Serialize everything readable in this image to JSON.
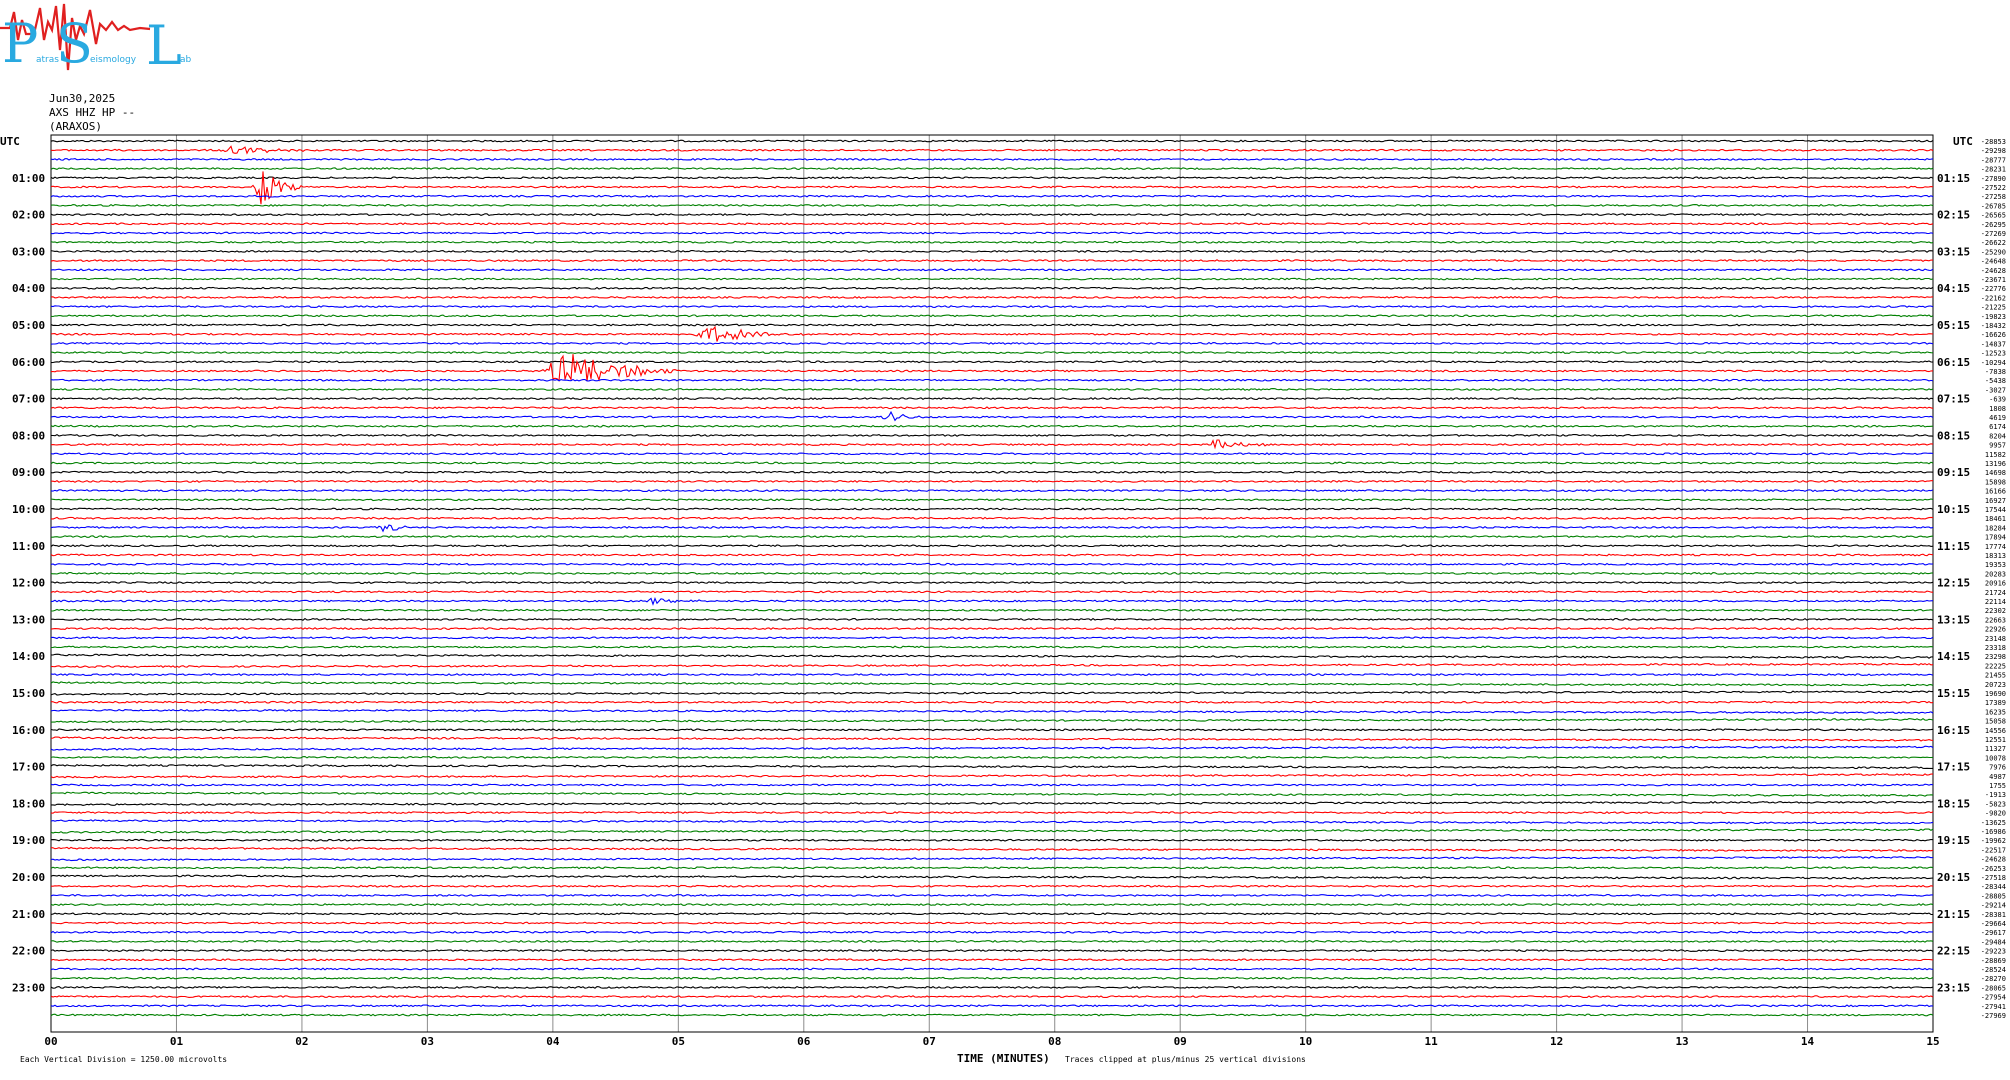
{
  "logo": {
    "letters": [
      "P",
      "S",
      "L"
    ],
    "small_text": [
      "atras",
      "eismology",
      "ab"
    ]
  },
  "header": {
    "date": "Jun30,2025",
    "channel": "AXS HHZ HP --",
    "station": "(ARAXOS)"
  },
  "colors": [
    "#000000",
    "#ff0000",
    "#0000ff",
    "#008000"
  ],
  "chart_data": {
    "type": "line",
    "subtype": "helicorder",
    "left_axis_label": "UTC",
    "right_axis_label": "UTC",
    "hour_labels_left": [
      "01:00",
      "02:00",
      "03:00",
      "04:00",
      "05:00",
      "06:00",
      "07:00",
      "08:00",
      "09:00",
      "10:00",
      "11:00",
      "12:00",
      "13:00",
      "14:00",
      "15:00",
      "16:00",
      "17:00",
      "18:00",
      "19:00",
      "20:00",
      "21:00",
      "22:00",
      "23:00"
    ],
    "hour_labels_right": [
      "01:15",
      "02:15",
      "03:15",
      "04:15",
      "05:15",
      "06:15",
      "07:15",
      "08:15",
      "09:15",
      "10:15",
      "11:15",
      "12:15",
      "13:15",
      "14:15",
      "15:15",
      "16:15",
      "17:15",
      "18:15",
      "19:15",
      "20:15",
      "21:15",
      "22:15",
      "23:15"
    ],
    "x_ticks": [
      "00",
      "01",
      "02",
      "03",
      "04",
      "05",
      "06",
      "07",
      "08",
      "09",
      "10",
      "11",
      "12",
      "13",
      "14",
      "15"
    ],
    "xlabel": "TIME (MINUTES)",
    "xlim": [
      0,
      15
    ],
    "offsets": [
      "-28853",
      "-29298",
      "-28777",
      "-28231",
      "-27890",
      "-27522",
      "-27258",
      "-26785",
      "-26565",
      "-26295",
      "-27269",
      "-26622",
      "-25290",
      "-24648",
      "-24628",
      "-23671",
      "-22776",
      "-22162",
      "-21225",
      "-19823",
      "-18432",
      "-16626",
      "-14837",
      "-12523",
      "-10294",
      "-7838",
      "-5438",
      "-3027",
      "-639",
      "1808",
      "4619",
      "6174",
      "8204",
      "9957",
      "11582",
      "13196",
      "14698",
      "15898",
      "16166",
      "16927",
      "17544",
      "18461",
      "18284",
      "17894",
      "17774",
      "18313",
      "19353",
      "20283",
      "20916",
      "21724",
      "22114",
      "22302",
      "22663",
      "22926",
      "23148",
      "23318",
      "23298",
      "22225",
      "21455",
      "20723",
      "19690",
      "17389",
      "16235",
      "15058",
      "14556",
      "12551",
      "11327",
      "10078",
      "7976",
      "4987",
      "1755",
      "-1913",
      "-5823",
      "-9820",
      "-13625",
      "-16986",
      "-19962",
      "-22517",
      "-24628",
      "-26253",
      "-27518",
      "-28344",
      "-28805",
      "-29214",
      "-28381",
      "-29664",
      "-29617",
      "-29484",
      "-29223",
      "-28869",
      "-28524",
      "-28270",
      "-28065",
      "-27954",
      "-27941",
      "-27969"
    ],
    "events": [
      {
        "row": 1,
        "start_min": 1.3,
        "end_min": 2.1,
        "amp": 0.5
      },
      {
        "row": 5,
        "start_min": 1.6,
        "end_min": 2.0,
        "amp": 2.2
      },
      {
        "row": 21,
        "start_min": 5.1,
        "end_min": 6.0,
        "amp": 0.9
      },
      {
        "row": 25,
        "start_min": 3.9,
        "end_min": 5.0,
        "amp": 2.2
      },
      {
        "row": 30,
        "start_min": 6.6,
        "end_min": 7.0,
        "amp": 0.6
      },
      {
        "row": 33,
        "start_min": 9.2,
        "end_min": 9.7,
        "amp": 0.6
      },
      {
        "row": 42,
        "start_min": 2.6,
        "end_min": 2.9,
        "amp": 0.6
      },
      {
        "row": 50,
        "start_min": 4.7,
        "end_min": 5.2,
        "amp": 0.4
      }
    ]
  },
  "footer": {
    "left": "Each Vertical Division = 1250.00 microvolts",
    "right": "Traces clipped at plus/minus 25 vertical divisions"
  }
}
